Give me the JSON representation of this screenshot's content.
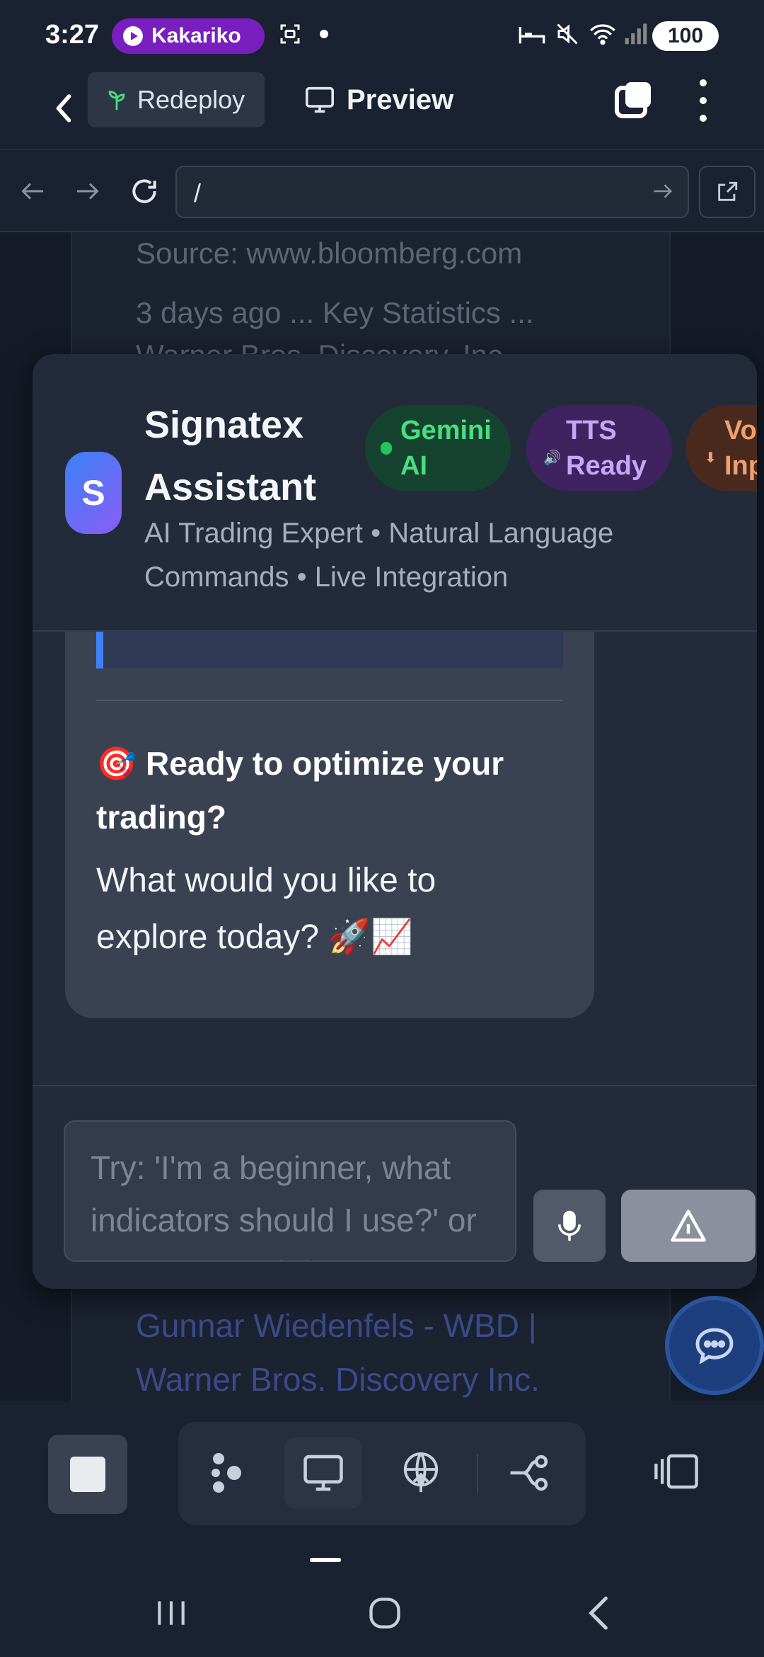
{
  "status_bar": {
    "time": "3:27",
    "app_pill": "Kakariko",
    "battery": "100"
  },
  "top_bar": {
    "redeploy_label": "Redeploy",
    "preview_label": "Preview"
  },
  "url_bar": {
    "url": "/"
  },
  "background_page": {
    "source_line": "Source: www.bloomberg.com",
    "snippet_line": "3 days ago ... Key Statistics ...",
    "snippet_line_2": "Warner Bros. Discovery, Inc",
    "link_text": "Gunnar Wiedenfels - WBD | Warner Bros. Discovery Inc."
  },
  "assistant": {
    "avatar_letter": "S",
    "title": "Signatex Assistant",
    "badges": {
      "gemini": "Gemini AI",
      "tts": "TTS Ready",
      "voice": "Voice Input"
    },
    "subtitle": "AI Trading Expert • Natural Language Commands • Live Integration",
    "message": {
      "heading": "🎯 Ready to optimize your trading?",
      "body": "What would you like to explore today? 🚀📈"
    },
    "input": {
      "placeholder": "Try: 'I'm a beginner, what indicators should I use?' or 'Set up a scalping strategy'"
    }
  },
  "icons": {
    "back": "chevron-left-icon",
    "redeploy": "sprout-icon",
    "preview": "monitor-icon",
    "tabs": "tabs-icon",
    "more": "kebab-icon",
    "mic": "mic-icon",
    "send": "send-icon",
    "chat": "chat-bubble-icon"
  },
  "colors": {
    "accent": "#3b82f6",
    "gemini_badge": "#15432f",
    "tts_badge": "#3f2360",
    "voice_badge": "#4a2a1f",
    "app_pill": "#7a1fbf"
  }
}
